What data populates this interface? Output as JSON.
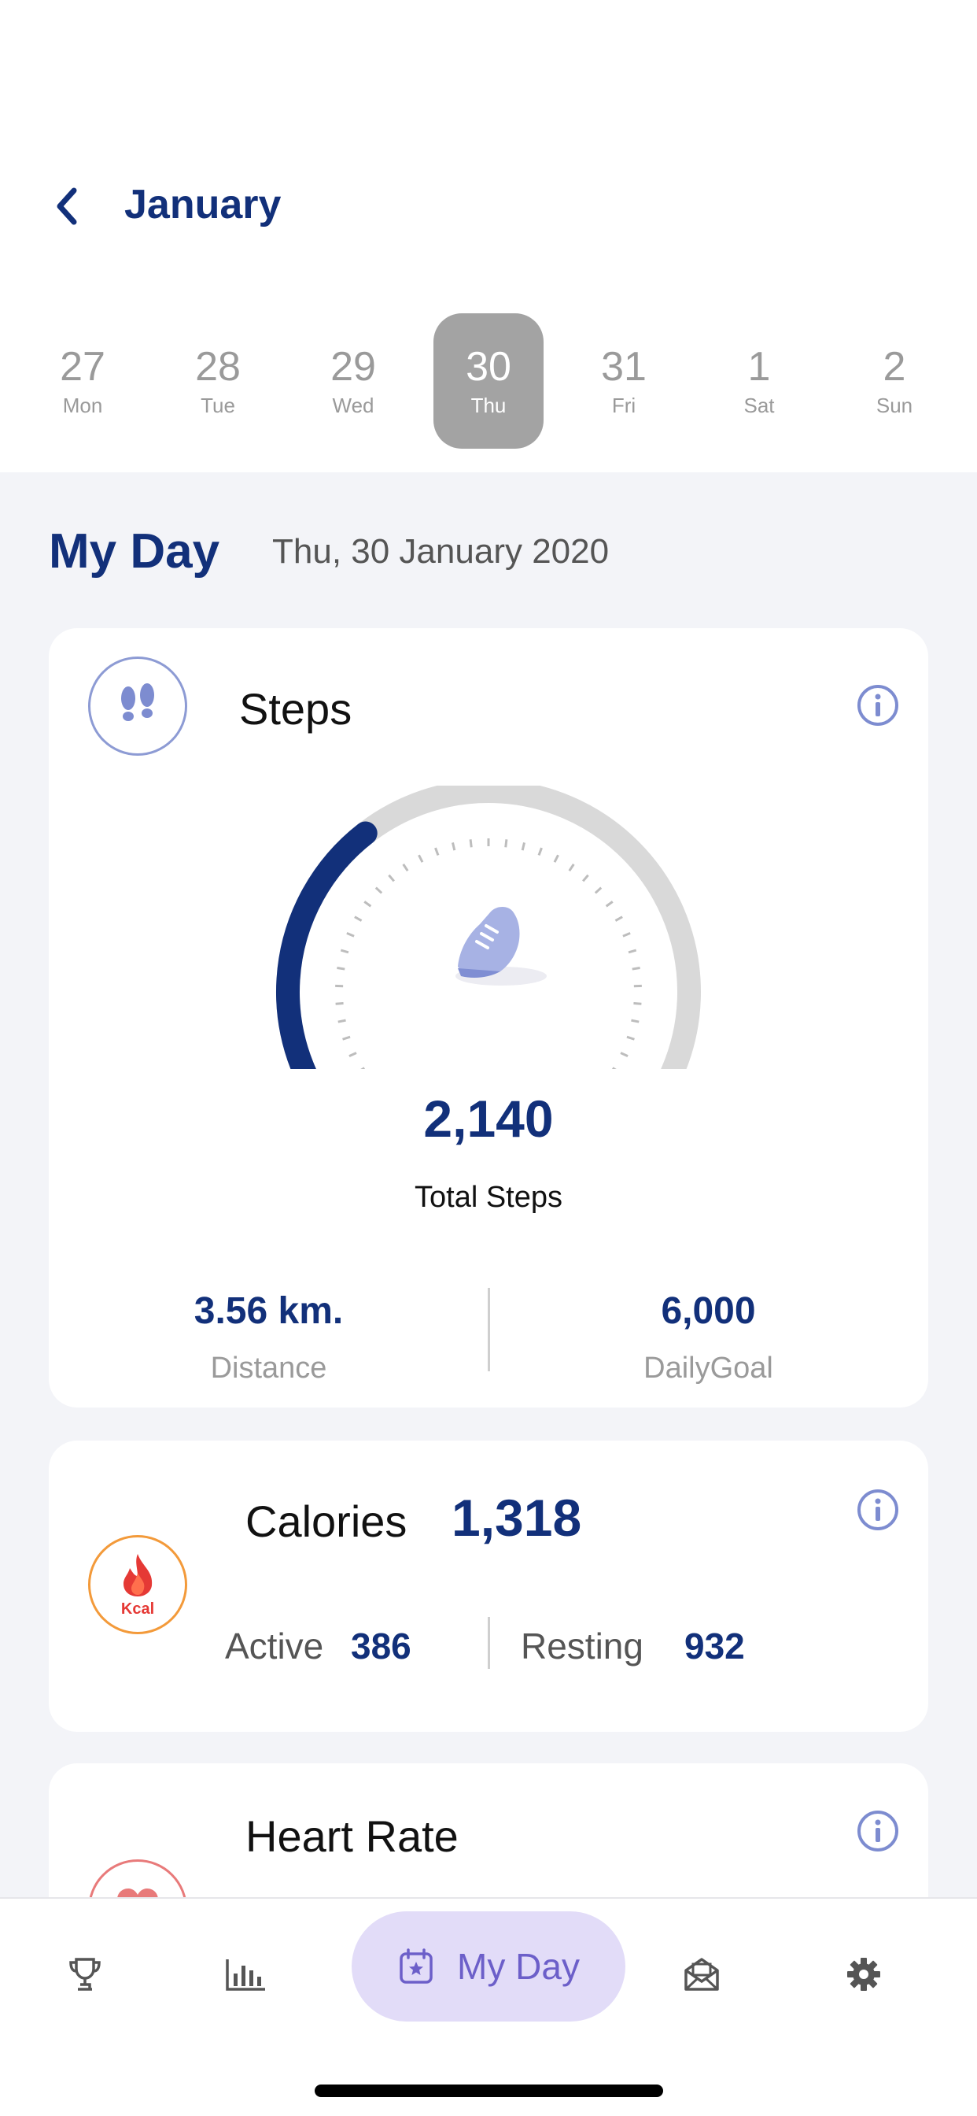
{
  "header": {
    "month": "January"
  },
  "week": [
    {
      "num": "27",
      "name": "Mon",
      "selected": false
    },
    {
      "num": "28",
      "name": "Tue",
      "selected": false
    },
    {
      "num": "29",
      "name": "Wed",
      "selected": false
    },
    {
      "num": "30",
      "name": "Thu",
      "selected": true
    },
    {
      "num": "31",
      "name": "Fri",
      "selected": false
    },
    {
      "num": "1",
      "name": "Sat",
      "selected": false
    },
    {
      "num": "2",
      "name": "Sun",
      "selected": false
    }
  ],
  "myday": {
    "title": "My Day",
    "date": "Thu, 30 January 2020"
  },
  "steps": {
    "title": "Steps",
    "total": "2,140",
    "total_label": "Total Steps",
    "progress_fraction": 0.36,
    "distance_value": "3.56 km.",
    "distance_label": "Distance",
    "goal_value": "6,000",
    "goal_label": "DailyGoal",
    "icon": "footprints-icon"
  },
  "calories": {
    "title": "Calories",
    "total": "1,318",
    "badge": "Kcal",
    "active_label": "Active",
    "active_value": "386",
    "resting_label": "Resting",
    "resting_value": "932"
  },
  "heart_rate": {
    "title": "Heart Rate"
  },
  "nav": {
    "items": [
      "trophy-icon",
      "bar-chart-icon",
      "calendar-star-icon",
      "mail-icon",
      "gear-icon"
    ],
    "active_label": "My Day"
  },
  "colors": {
    "primary": "#12307a",
    "accent_purple": "#6c5fc9",
    "calorie_orange": "#f39a3a",
    "heart_red": "#e87a7a",
    "selected_day_bg": "#a3a3a3"
  }
}
